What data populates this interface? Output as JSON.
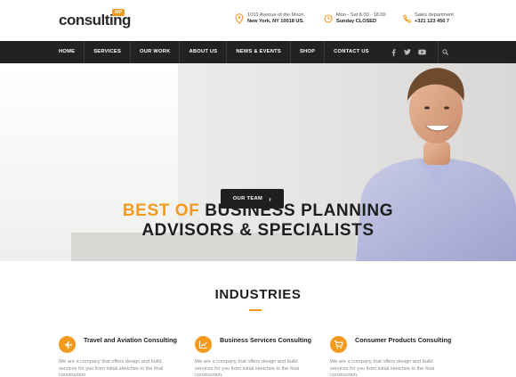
{
  "header": {
    "logo_text": "consulting",
    "logo_badge": "WP",
    "address": {
      "line1": "1010 Avenue of the Moon",
      "line2": "New York, NY 10018 US."
    },
    "hours": {
      "line1": "Mon - Sat 8.00 - 18.00",
      "line2": "Sunday CLOSED"
    },
    "phone": {
      "line1": "Sales department",
      "line2": "+321 123 456 7"
    }
  },
  "nav": {
    "items": [
      "HOME",
      "SERVICES",
      "OUR WORK",
      "ABOUT US",
      "NEWS & EVENTS",
      "SHOP",
      "CONTACT US"
    ],
    "social_icons": [
      "facebook-icon",
      "twitter-icon",
      "youtube-icon"
    ],
    "search_icon": "search-icon"
  },
  "hero": {
    "title_accent": "BEST OF",
    "title_rest": "BUSINESS PLANNING",
    "title_line2": "ADVISORS & SPECIALISTS",
    "button_label": "OUR TEAM"
  },
  "industries": {
    "title": "INDUSTRIES",
    "cards": [
      {
        "title": "Travel and Aviation Consulting",
        "desc": "We are a company that offers design and build services for you from initial sketches to the final construction.",
        "icon": "airplane-icon"
      },
      {
        "title": "Business Services Consulting",
        "desc": "We are a company that offers design and build services for you from initial sketches to the final construction.",
        "icon": "chart-icon"
      },
      {
        "title": "Consumer Products Consulting",
        "desc": "We are a company that offers design and build services for you from initial sketches to the final construction.",
        "icon": "cart-icon"
      }
    ]
  },
  "colors": {
    "accent": "#f39a1e",
    "nav_bg": "#222222",
    "text_dark": "#1e1e1e"
  }
}
